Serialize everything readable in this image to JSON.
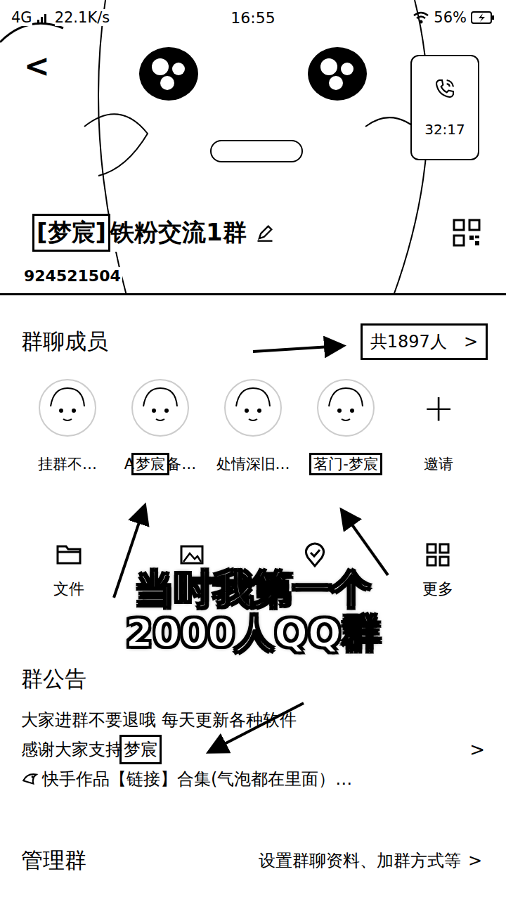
{
  "status_bar": {
    "network": "4G",
    "speed": "22.1K/s",
    "time": "16:55",
    "battery": "56%"
  },
  "header": {
    "back": "<"
  },
  "call": {
    "duration": "32:17"
  },
  "group": {
    "name": [
      {
        "text": "[梦宸]",
        "highlighted": true
      },
      {
        "text": " 铁粉交流1群",
        "highlighted": false
      }
    ],
    "number": "924521504"
  },
  "members": {
    "title": "群聊成员",
    "count": "共1897人",
    "count_highlighted": true,
    "chevron": ">",
    "items": [
      {
        "name": [
          {
            "text": "挂群不…",
            "highlighted": false
          }
        ]
      },
      {
        "name": [
          {
            "text": "A",
            "highlighted": false
          },
          {
            "text": "梦宸",
            "highlighted": true
          },
          {
            "text": "备…",
            "highlighted": false
          }
        ]
      },
      {
        "name": [
          {
            "text": "处情深旧…",
            "highlighted": false
          }
        ]
      },
      {
        "name": [
          {
            "text": "茗门-梦宸",
            "highlighted": true
          }
        ]
      }
    ],
    "invite": {
      "icon": "+",
      "label": "邀请"
    }
  },
  "actions": [
    {
      "kind": "file",
      "label": "文件"
    },
    {
      "kind": "album"
    },
    {
      "kind": "checkin"
    },
    {
      "kind": "more",
      "label": "更多"
    }
  ],
  "caption": {
    "lines": [
      "当时我第一个",
      "2000人QQ群"
    ]
  },
  "notice": {
    "title": "群公告",
    "chevron": ">",
    "lines": [
      {
        "has_icon": false,
        "segments": [
          {
            "text": "大家进群不要退哦 每天更新各种软件",
            "highlighted": false
          }
        ]
      },
      {
        "has_icon": false,
        "segments": [
          {
            "text": "感谢大家支持",
            "highlighted": false
          },
          {
            "text": "梦宸",
            "highlighted": true
          }
        ]
      },
      {
        "has_icon": true,
        "segments": [
          {
            "text": "快手作品【链接】合集(气泡都在里面）…",
            "highlighted": false
          }
        ]
      }
    ]
  },
  "manage": {
    "title": "管理群",
    "hint": "设置群聊资料、加群方式等",
    "chevron": ">"
  }
}
